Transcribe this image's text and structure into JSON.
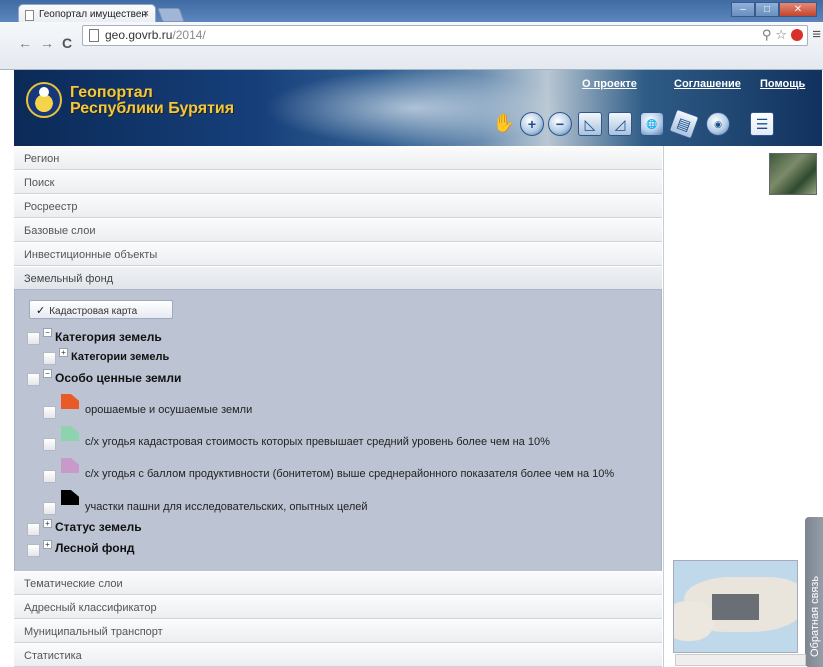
{
  "browser": {
    "tab_title": "Геопортал имуществен",
    "tab_close": "×",
    "url_host": "geo.govrb.ru",
    "url_path": "/2014/",
    "menu_glyph": "≡"
  },
  "site": {
    "title_line1": "Геопортал",
    "title_line2": "Республики Бурятия",
    "links": [
      "О проекте",
      "Соглашение",
      "Помощь"
    ],
    "tools": [
      "pan-hand",
      "zoom-in",
      "zoom-out",
      "measure-ruler",
      "measure-area",
      "www-layer",
      "layers",
      "overview",
      "legend"
    ]
  },
  "panel": {
    "sections_top": [
      "Регион",
      "Поиск",
      "Росреестр",
      "Базовые слои",
      "Инвестиционные объекты",
      "Земельный фонд"
    ],
    "kadastr_button": "Кадастровая карта",
    "tree": {
      "category": "Категория земель",
      "category_child": "Категории земель",
      "special": "Особо ценные земли",
      "leaves": [
        {
          "label": "орошаемые и осушаемые земли",
          "color": "#e85a28"
        },
        {
          "label": "с/х угодья кадастровая стоимость которых превышает средний уровень более чем на 10%",
          "color": "#8fd2b0"
        },
        {
          "label": "с/х угодья с баллом продуктивности (бонитетом) выше среднерайонного показателя более чем на 10%",
          "color": "#c79ac9"
        },
        {
          "label": "участки пашни для исследовательских, опытных целей",
          "color": "#000000"
        }
      ],
      "status": "Статус земель",
      "forest": "Лесной фонд"
    },
    "sections_bottom": [
      "Тематические слои",
      "Адресный классификатор",
      "Муниципальный транспорт",
      "Статистика"
    ]
  },
  "map": {
    "feedback_label": "Обратная связь"
  }
}
